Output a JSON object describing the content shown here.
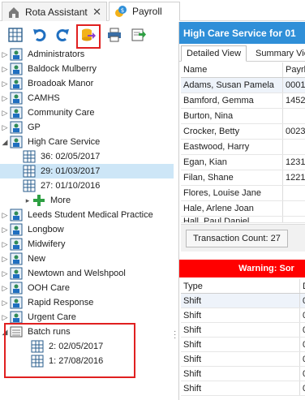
{
  "tabs": [
    {
      "label": "Rota Assistant",
      "close": "✕",
      "icon": "home-icon"
    },
    {
      "label": "Payroll",
      "icon": "payroll-icon"
    }
  ],
  "toolbar": [
    "grid-icon",
    "undo-icon",
    "redo-icon",
    "export-icon",
    "print-icon",
    "import-icon"
  ],
  "tree": {
    "items": [
      "Administrators",
      "Baldock Mulberry",
      "Broadoak Manor",
      "CAMHS",
      "Community Care",
      "GP",
      "High Care Service"
    ],
    "high_care_children": [
      "36: 02/05/2017",
      "29: 01/03/2017",
      "27: 01/10/2016",
      "More"
    ],
    "items_after": [
      "Leeds Student Medical Practice",
      "Longbow",
      "Midwifery",
      "New",
      "Newtown and Welshpool",
      "OOH Care",
      "Rapid Response",
      "Urgent Care"
    ],
    "batch_runs": "Batch runs",
    "batch_children": [
      "2: 02/05/2017",
      "1: 27/08/2016"
    ]
  },
  "right": {
    "title": "High Care Service for 01",
    "subtabs": [
      "Detailed View",
      "Summary Vie"
    ],
    "grid1": {
      "headers": [
        "Name",
        "Payrl"
      ],
      "rows": [
        [
          "Adams, Susan Pamela",
          "0001"
        ],
        [
          "Bamford, Gemma",
          "1452"
        ],
        [
          "Burton, Nina",
          ""
        ],
        [
          "Crocker, Betty",
          "0023"
        ],
        [
          "Eastwood, Harry",
          ""
        ],
        [
          "Egan, Kian",
          "1231"
        ],
        [
          "Filan, Shane",
          "1221"
        ],
        [
          "Flores, Louise Jane",
          ""
        ],
        [
          "Hale, Arlene Joan",
          ""
        ],
        [
          "Hall, Paul Daniel",
          ""
        ]
      ]
    },
    "transaction_count": "Transaction Count: 27",
    "warning": "Warning: Sor",
    "grid2": {
      "headers": [
        "Type",
        "D"
      ],
      "rows": [
        [
          "Shift",
          "0"
        ],
        [
          "Shift",
          "0"
        ],
        [
          "Shift",
          "0"
        ],
        [
          "Shift",
          "0"
        ],
        [
          "Shift",
          "0"
        ],
        [
          "Shift",
          "0"
        ],
        [
          "Shift",
          "0"
        ]
      ]
    }
  },
  "colors": {
    "accent": "#2f8fd8",
    "warning": "#ff0000",
    "highlight": "#e02020",
    "selected": "#cde6f7"
  }
}
